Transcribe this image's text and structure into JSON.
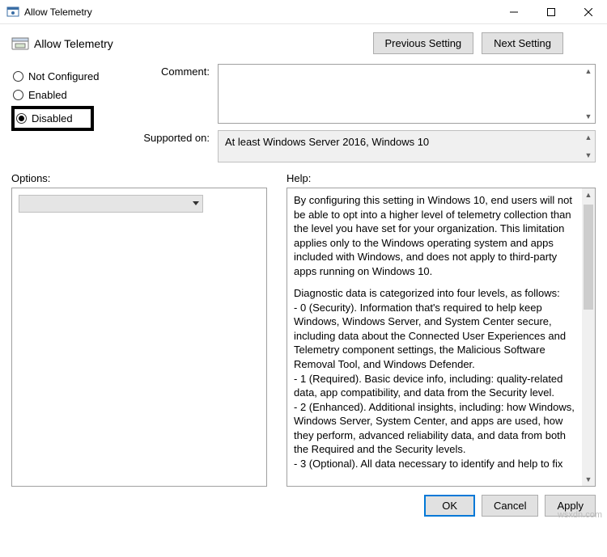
{
  "window": {
    "title": "Allow Telemetry"
  },
  "header": {
    "title": "Allow Telemetry",
    "prev_label": "Previous Setting",
    "next_label": "Next Setting"
  },
  "radios": {
    "not_configured": "Not Configured",
    "enabled": "Enabled",
    "disabled": "Disabled",
    "selected": "disabled"
  },
  "fields": {
    "comment_label": "Comment:",
    "comment_value": "",
    "supported_label": "Supported on:",
    "supported_value": "At least Windows Server 2016, Windows 10"
  },
  "panels": {
    "options_label": "Options:",
    "help_label": "Help:"
  },
  "help": {
    "p1": "By configuring this setting in Windows 10, end users will not be able to opt into a higher level of telemetry collection than the level you have set for your organization.  This limitation applies only to the Windows operating system and apps included with Windows, and does not apply to third-party apps running on Windows 10.",
    "p2": "Diagnostic data is categorized into four levels, as follows:",
    "l0": "  - 0 (Security). Information that's required to help keep Windows, Windows Server, and System Center secure, including data about the Connected User Experiences and Telemetry component settings, the Malicious Software Removal Tool, and Windows Defender.",
    "l1": "  - 1 (Required). Basic device info, including: quality-related data, app compatibility, and data from the Security level.",
    "l2": "  - 2 (Enhanced). Additional insights, including: how Windows, Windows Server, System Center, and apps are used, how they perform, advanced reliability data, and data from both the Required and the Security levels.",
    "l3": "  - 3 (Optional). All data necessary to identify and help to fix"
  },
  "buttons": {
    "ok": "OK",
    "cancel": "Cancel",
    "apply": "Apply"
  },
  "watermark": "wsxdn.com"
}
